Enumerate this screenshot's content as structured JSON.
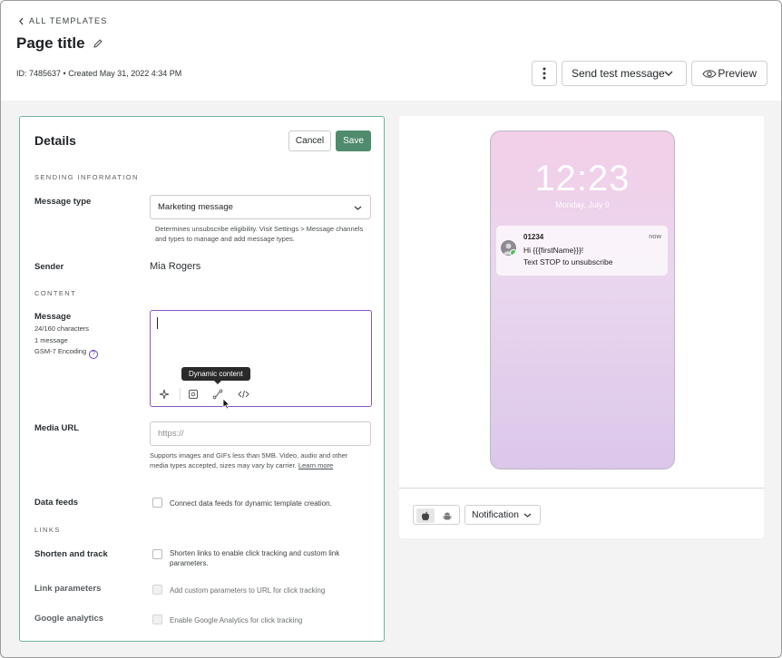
{
  "header": {
    "back_label": "ALL TEMPLATES",
    "page_title": "Page title",
    "meta": "ID: 7485637  •  Created May 31, 2022 4:34 PM",
    "send_test_label": "Send test message",
    "preview_label": "Preview"
  },
  "details": {
    "title": "Details",
    "cancel_label": "Cancel",
    "save_label": "Save",
    "sending_section": "SENDING INFORMATION",
    "message_type_label": "Message type",
    "message_type_value": "Marketing message",
    "message_type_help": "Determines unsubscribe eligibility. Visit Settings > Message channels and types to manage and add message types.",
    "sender_label": "Sender",
    "sender_value": "Mia Rogers",
    "content_section": "CONTENT",
    "message_label": "Message",
    "char_count": "24/160 characters",
    "message_count": "1 message",
    "encoding": "GSM-7 Encoding",
    "tooltip": "Dynamic content",
    "media_url_label": "Media URL",
    "media_url_placeholder": "https://",
    "media_help": "Supports images and GIFs less than 5MB. Video, audio and other media types accepted, sizes may vary by carrier.",
    "learn_more": "Learn more",
    "data_feeds_label": "Data feeds",
    "data_feeds_text": "Connect data feeds for dynamic template creation.",
    "links_section": "LINKS",
    "shorten_label": "Shorten and track",
    "shorten_text": "Shorten links to enable click tracking and custom link parameters.",
    "link_params_label": "Link parameters",
    "link_params_text": "Add custom parameters to URL for click tracking",
    "ga_label": "Google analytics",
    "ga_text": "Enable Google Analytics for click tracking"
  },
  "preview": {
    "time": "12:23",
    "date": "Monday, July 9",
    "notif_from": "01234",
    "notif_time": "now",
    "notif_line1": "Hi {{{firstName}}}!",
    "notif_line2": "Text STOP to unsubscribe",
    "view_select": "Notification"
  },
  "icons": [
    "chevron-left-icon",
    "pencil-icon",
    "kebab-icon",
    "chevron-down-icon",
    "eye-icon",
    "help-icon",
    "sparkle-icon",
    "braces-icon",
    "dynamic-content-icon",
    "code-icon",
    "apple-icon",
    "android-icon"
  ],
  "colors": {
    "save": "#4f8c6d",
    "panel_border": "#6fb59a",
    "editor_focus": "#8a56c6",
    "help_icon": "#6a45b5"
  }
}
